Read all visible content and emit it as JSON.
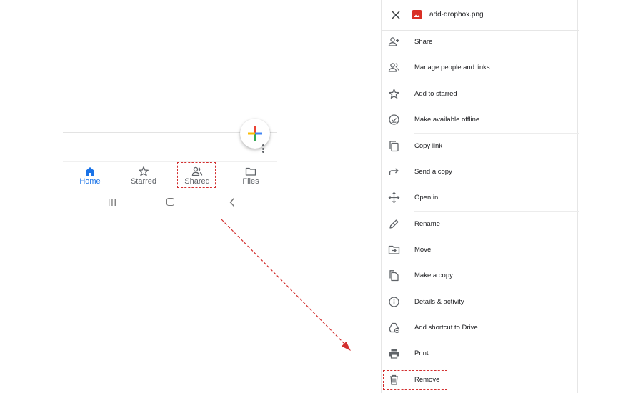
{
  "bottom_nav": {
    "items": [
      {
        "label": "Home",
        "icon": "home-icon",
        "active": true
      },
      {
        "label": "Starred",
        "icon": "star-icon",
        "active": false
      },
      {
        "label": "Shared",
        "icon": "people-icon",
        "active": false
      },
      {
        "label": "Files",
        "icon": "folder-icon",
        "active": false
      }
    ]
  },
  "fab": {
    "icon": "plus-multicolor-icon"
  },
  "file_menu": {
    "file_name": "add-dropbox.png",
    "file_icon": "image-file-icon",
    "items": [
      {
        "label": "Share",
        "icon": "person-add-icon"
      },
      {
        "label": "Manage people and links",
        "icon": "people-icon"
      },
      {
        "label": "Add to starred",
        "icon": "star-icon"
      },
      {
        "label": "Make available offline",
        "icon": "offline-check-icon"
      },
      {
        "label": "Copy link",
        "icon": "copy-link-icon"
      },
      {
        "label": "Send a copy",
        "icon": "forward-arrow-icon"
      },
      {
        "label": "Open in",
        "icon": "move-arrows-icon"
      },
      {
        "label": "Rename",
        "icon": "pencil-icon"
      },
      {
        "label": "Move",
        "icon": "folder-move-icon"
      },
      {
        "label": "Make a copy",
        "icon": "duplicate-icon"
      },
      {
        "label": "Details & activity",
        "icon": "info-icon"
      },
      {
        "label": "Add shortcut to Drive",
        "icon": "drive-shortcut-icon"
      },
      {
        "label": "Print",
        "icon": "printer-icon"
      },
      {
        "label": "Remove",
        "icon": "trash-icon"
      }
    ]
  },
  "colors": {
    "accent_blue": "#1a73e8",
    "annotation_red": "#d32f2f",
    "file_icon_red": "#d93025",
    "icon_gray": "#5f6368"
  }
}
